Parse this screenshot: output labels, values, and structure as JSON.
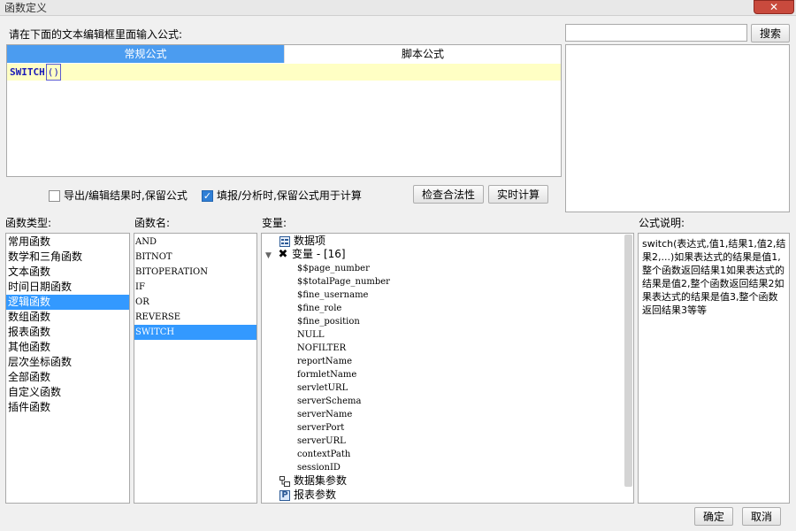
{
  "window": {
    "title": "函数定义",
    "close_label": "✕"
  },
  "search": {
    "value": "",
    "button_label": "搜索"
  },
  "editor": {
    "prompt": "请在下面的文本编辑框里面输入公式:",
    "tabs": [
      {
        "label": "常规公式",
        "active": true
      },
      {
        "label": "脚本公式",
        "active": false
      }
    ],
    "formula_name": "SWITCH",
    "formula_open": "(",
    "formula_close": ")"
  },
  "options": {
    "keep_on_export": {
      "label": "导出/编辑结果时,保留公式",
      "checked": false
    },
    "keep_on_fill": {
      "label": "填报/分析时,保留公式用于计算",
      "checked": true
    },
    "check_validity_label": "检查合法性",
    "realtime_calc_label": "实时计算"
  },
  "categories": {
    "title": "函数类型:",
    "items": [
      "常用函数",
      "数学和三角函数",
      "文本函数",
      "时间日期函数",
      "逻辑函数",
      "数组函数",
      "报表函数",
      "其他函数",
      "层次坐标函数",
      "全部函数",
      "自定义函数",
      "插件函数"
    ],
    "selected": "逻辑函数"
  },
  "functions": {
    "title": "函数名:",
    "items": [
      "AND",
      "BITNOT",
      "BITOPERATION",
      "IF",
      "OR",
      "REVERSE",
      "SWITCH"
    ],
    "selected": "SWITCH"
  },
  "variables": {
    "title": "变量:",
    "data_items_label": "数据项",
    "variable_group_label": "变量 - [16]",
    "variable_items": [
      "$$page_number",
      "$$totalPage_number",
      "$fine_username",
      "$fine_role",
      "$fine_position",
      "NULL",
      "NOFILTER",
      "reportName",
      "formletName",
      "servletURL",
      "serverSchema",
      "serverName",
      "serverPort",
      "serverURL",
      "contextPath",
      "sessionID"
    ],
    "dataset_params_label": "数据集参数",
    "report_params_label": "报表参数",
    "icon_names": [
      "data-item-icon",
      "variable-icon",
      "dataset-param-icon",
      "report-param-icon"
    ]
  },
  "description": {
    "title": "公式说明:",
    "text": "switch(表达式,值1,结果1,值2,结果2,...)如果表达式的结果是值1,整个函数返回结果1如果表达式的结果是值2,整个函数返回结果2如果表达式的结果是值3,整个函数返回结果3等等"
  },
  "footer": {
    "ok_label": "确定",
    "cancel_label": "取消"
  },
  "colors": {
    "accent": "#3399ff",
    "tab_active": "#4b9cf0",
    "editor_line": "#ffffc4",
    "formula_text": "#1a1ab8",
    "close_button": "#c94a3d"
  }
}
